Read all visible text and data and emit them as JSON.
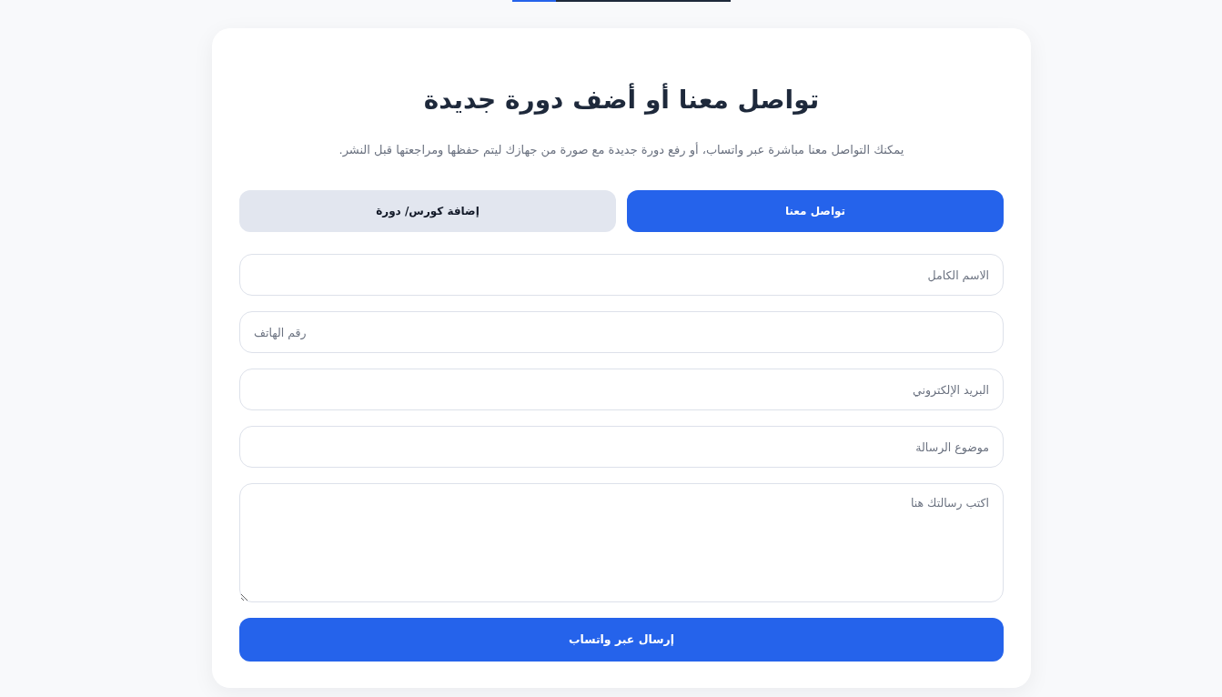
{
  "heading": {
    "title": "تواصل معنا أو أضف دورة جديدة",
    "subtitle": "يمكنك التواصل معنا مباشرة عبر واتساب، أو رفع دورة جديدة مع صورة من جهازك ليتم حفظها ومراجعتها قبل النشر."
  },
  "tabs": [
    {
      "label": "تواصل معنا",
      "selected": true
    },
    {
      "label": "إضافة كورس/ دورة",
      "selected": false
    }
  ],
  "fields": [
    {
      "kind": "text",
      "placeholder": "الاسم الكامل"
    },
    {
      "kind": "phone",
      "placeholder": "رقم الهاتف"
    },
    {
      "kind": "email",
      "placeholder": "البريد الإلكتروني"
    },
    {
      "kind": "text",
      "placeholder": "موضوع الرسالة"
    },
    {
      "kind": "textarea",
      "placeholder": "اكتب رسالتك هنا"
    }
  ],
  "submit_button": {
    "label": "إرسال عبر واتساب"
  }
}
